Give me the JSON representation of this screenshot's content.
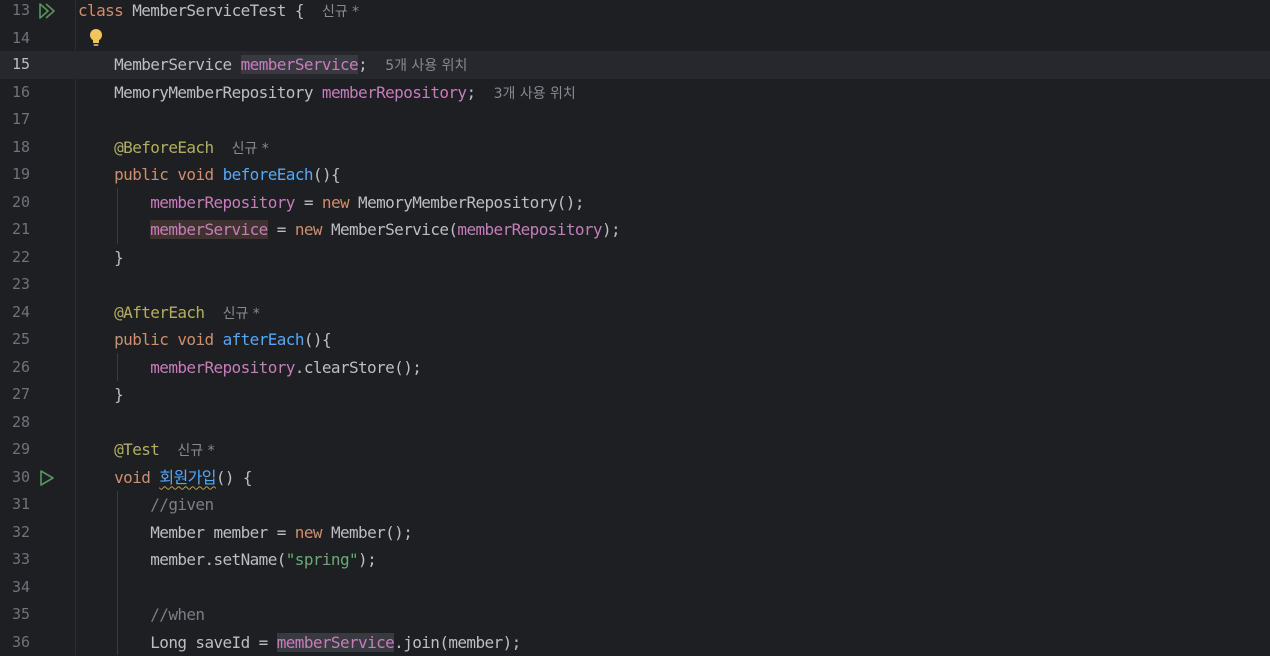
{
  "editor": {
    "current_line": 15,
    "lines": [
      {
        "n": "13",
        "parts": {
          "kw1": "class",
          "cls": "MemberServiceTest",
          "brace": "{",
          "hint": "신규 *"
        }
      },
      {
        "n": "14"
      },
      {
        "n": "15",
        "parts": {
          "type": "MemberService",
          "field": "memberService",
          "semi": ";",
          "hint": "5개 사용 위치"
        }
      },
      {
        "n": "16",
        "parts": {
          "type": "MemoryMemberRepository",
          "field": "memberRepository",
          "semi": ";",
          "hint": "3개 사용 위치"
        }
      },
      {
        "n": "17"
      },
      {
        "n": "18",
        "parts": {
          "ann": "@BeforeEach",
          "hint": "신규 *"
        }
      },
      {
        "n": "19",
        "parts": {
          "kw1": "public",
          "kw2": "void",
          "fn": "beforeEach",
          "rest": "(){"
        }
      },
      {
        "n": "20",
        "parts": {
          "field": "memberRepository",
          "eq": " = ",
          "kw": "new",
          "rest": " MemoryMemberRepository();"
        }
      },
      {
        "n": "21",
        "parts": {
          "field": "memberService",
          "eq": " = ",
          "kw": "new",
          "call": " MemberService(",
          "arg": "memberRepository",
          "end": ");"
        }
      },
      {
        "n": "22",
        "parts": {
          "rest": "}"
        }
      },
      {
        "n": "23"
      },
      {
        "n": "24",
        "parts": {
          "ann": "@AfterEach",
          "hint": "신규 *"
        }
      },
      {
        "n": "25",
        "parts": {
          "kw1": "public",
          "kw2": "void",
          "fn": "afterEach",
          "rest": "(){"
        }
      },
      {
        "n": "26",
        "parts": {
          "field": "memberRepository",
          "rest": ".clearStore();"
        }
      },
      {
        "n": "27",
        "parts": {
          "rest": "}"
        }
      },
      {
        "n": "28"
      },
      {
        "n": "29",
        "parts": {
          "ann": "@Test",
          "hint": "신규 *"
        }
      },
      {
        "n": "30",
        "parts": {
          "kw1": "void",
          "fn": "회원가입",
          "rest": "() {"
        }
      },
      {
        "n": "31",
        "parts": {
          "cmt": "//given"
        }
      },
      {
        "n": "32",
        "parts": {
          "pre": "Member member = ",
          "kw": "new",
          "rest": " Member();"
        }
      },
      {
        "n": "33",
        "parts": {
          "pre": "member.setName(",
          "str": "\"spring\"",
          "rest": ");"
        }
      },
      {
        "n": "34"
      },
      {
        "n": "35",
        "parts": {
          "cmt": "//when"
        }
      },
      {
        "n": "36",
        "parts": {
          "pre": "Long saveId = ",
          "field": "memberService",
          "rest": ".join(member);"
        }
      }
    ]
  },
  "icons": {
    "run_class": "run-all-tests-icon",
    "run_method": "run-test-icon",
    "intention": "lightbulb-icon"
  },
  "colors": {
    "background": "#1e1f22",
    "keyword": "#cf8e6d",
    "field": "#c77dbb",
    "annotation": "#b3ae60",
    "function": "#56a8f5",
    "string": "#6aab73",
    "comment": "#7a7e85"
  }
}
